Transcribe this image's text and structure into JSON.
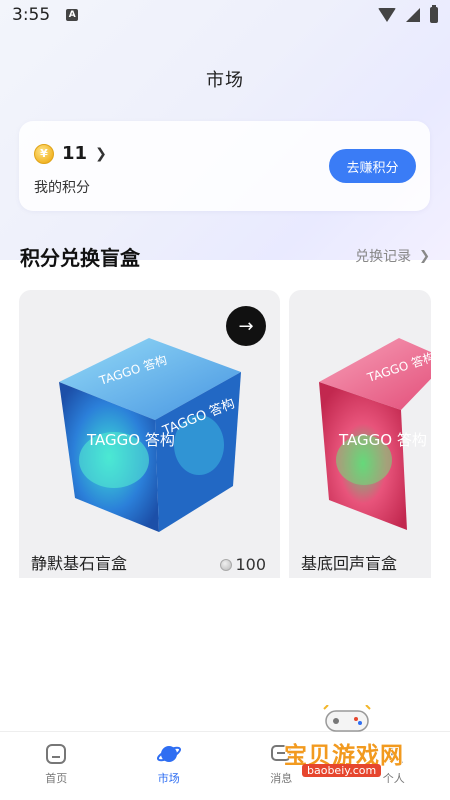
{
  "status_bar": {
    "time": "3:55",
    "notification_icon": "A"
  },
  "header": {
    "title": "市场"
  },
  "points": {
    "value": "11",
    "label": "我的积分",
    "coin_icon": "coin-icon",
    "earn_button": "去赚积分"
  },
  "section": {
    "title": "积分兑换盲盒",
    "history_link": "兑换记录"
  },
  "boxes": [
    {
      "name": "静默基石盲盒",
      "price": "100",
      "logo_text": "TAGGO 答构",
      "color": "#2a7fd8"
    },
    {
      "name": "基底回声盲盒",
      "logo_text": "TAGGO 答构",
      "color": "#e84c7a"
    }
  ],
  "tabbar": {
    "items": [
      {
        "label": "首页",
        "icon": "home-icon"
      },
      {
        "label": "市场",
        "icon": "planet-icon"
      },
      {
        "label": "消息",
        "icon": "message-icon"
      },
      {
        "label": "个人",
        "icon": "profile-icon"
      }
    ],
    "active": "市场"
  },
  "watermark": {
    "text": "宝贝游戏网",
    "url": "baobeiy.com"
  },
  "colors": {
    "accent": "#3a7cf6",
    "tab_active": "#2f6ef2"
  }
}
